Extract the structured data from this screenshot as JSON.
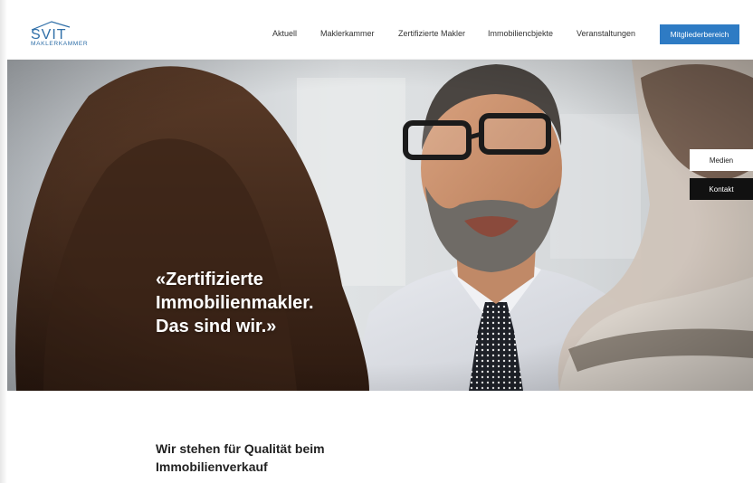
{
  "header": {
    "logo_text": "SVIT",
    "logo_subtext": "MAKLERKAMMER",
    "nav": [
      {
        "label": "Aktuell"
      },
      {
        "label": "Maklerkammer"
      },
      {
        "label": "Zertifizierte Makler"
      },
      {
        "label": "Immobiliencbjekte"
      },
      {
        "label": "Veranstaltungen"
      }
    ],
    "member_button": "Mitgliederbereich"
  },
  "hero": {
    "title_lines": [
      "«Zertifizierte",
      "Immobilienmakler.",
      "Das sind wir.»"
    ],
    "side_buttons": {
      "medien": "Medien",
      "kontakt": "Kontakt"
    }
  },
  "content": {
    "heading_lines": [
      "Wir stehen für Qualität beim",
      "Immobilienverkauf"
    ]
  },
  "colors": {
    "brand_blue": "#2e7bc4",
    "logo_blue": "#2f6fa8",
    "kontakt_bg": "#111111"
  }
}
